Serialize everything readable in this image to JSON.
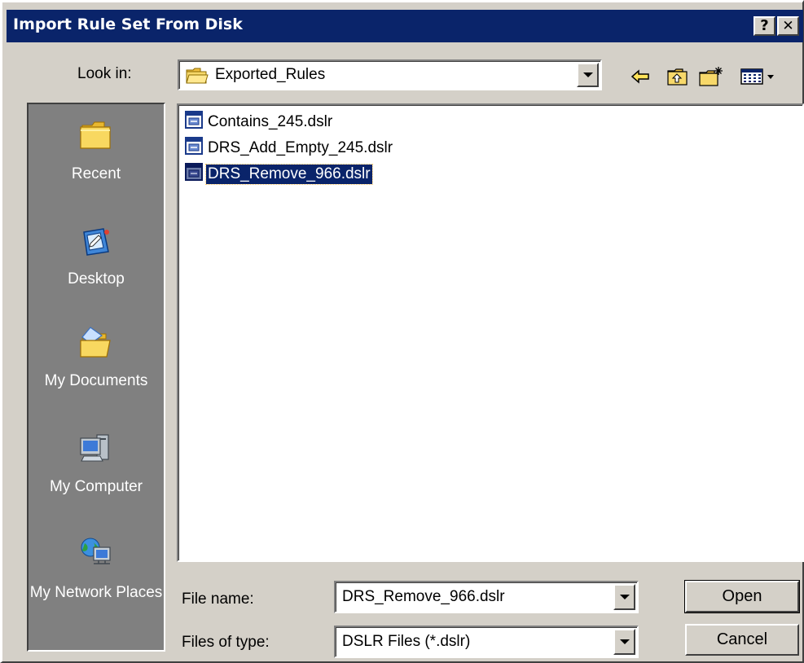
{
  "window": {
    "title": "Import Rule Set From Disk",
    "help_button": "?",
    "close_button": "✕"
  },
  "lookin": {
    "label": "Look in:",
    "value": "Exported_Rules",
    "icon": "folder-open-icon"
  },
  "toolbar": {
    "icons": [
      "back-arrow-icon",
      "up-one-level-icon",
      "create-new-folder-icon",
      "view-menu-icon"
    ]
  },
  "places": [
    {
      "label": "Recent",
      "icon": "recent-folder-icon"
    },
    {
      "label": "Desktop",
      "icon": "desktop-icon"
    },
    {
      "label": "My Documents",
      "icon": "my-documents-icon"
    },
    {
      "label": "My Computer",
      "icon": "my-computer-icon"
    },
    {
      "label": "My Network Places",
      "icon": "network-places-icon"
    }
  ],
  "files": [
    {
      "name": "Contains_245.dslr",
      "selected": false
    },
    {
      "name": "DRS_Add_Empty_245.dslr",
      "selected": false
    },
    {
      "name": "DRS_Remove_966.dslr",
      "selected": true
    }
  ],
  "filename": {
    "label": "File name:",
    "value": "DRS_Remove_966.dslr"
  },
  "filetype": {
    "label": "Files of type:",
    "value": "DSLR Files (*.dslr)"
  },
  "buttons": {
    "open": "Open",
    "cancel": "Cancel"
  },
  "colors": {
    "titlebar": "#0a246a",
    "face": "#d4d0c8",
    "places_bar": "#808080",
    "selection": "#0a246a"
  }
}
